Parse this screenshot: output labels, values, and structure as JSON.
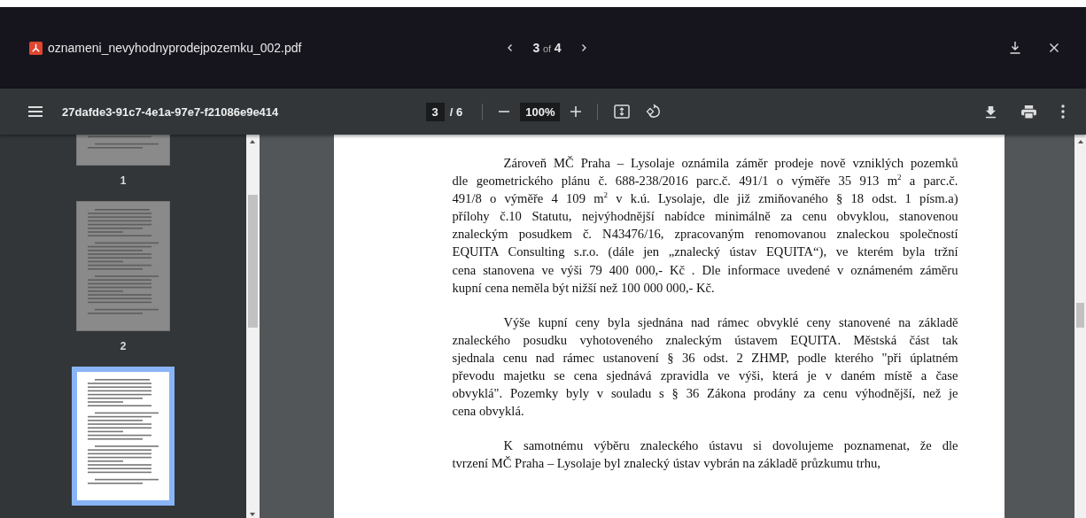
{
  "header": {
    "file_name": "oznameni_nevyhodnyprodejpozemku_002.pdf",
    "pager": {
      "current": "3",
      "of": "of",
      "total": "4"
    }
  },
  "toolbar": {
    "document_title": "27dafde3-91c7-4e1a-97e7-f21086e9e414",
    "page_input": "3",
    "page_total": "/ 6",
    "zoom": "100%"
  },
  "thumbnails": [
    {
      "label": "1",
      "selected": false
    },
    {
      "label": "2",
      "selected": false
    },
    {
      "selected": true
    }
  ],
  "page": {
    "paragraphs": [
      {
        "lines": [
          "Zároveň MČ Praha – Lysolaje oznámila záměr prodeje nově vzniklých pozemků",
          "dle geometrického plánu č. 688-238/2016 parc.č. 491/1 o výměře 35 913 m$^{2}$ a parc.č.",
          "491/8 o výměře 4 109 m$^{2}$ v k.ú. Lysolaje, dle již zmiňovaného § 18 odst. 1 písm.a)",
          "přílohy č.10 Statutu, nejvýhodnější nabídce minimálně za cenu obvyklou, stanovenou",
          "znaleckým posudkem č. N43476/16, zpracovaným renomovanou znaleckou společností",
          "EQUITA Consulting s.r.o. (dále jen „znalecký ústav EQUITA“), ve kterém byla tržní",
          "cena stanovena ve výši 79 400 000,- Kč . Dle informace uvedené v oznámeném záměru",
          "kupní cena neměla být nižší než 100 000 000,- Kč."
        ]
      },
      {
        "lines": [
          "Výše kupní ceny byla sjednána nad rámec obvyklé ceny stanovené na základě",
          "znaleckého posudku vyhotoveného znaleckým ústavem EQUITA. Městská část tak",
          "sjednala cenu nad rámec ustanovení § 36 odst. 2 ZHMP, podle kterého \"při úplatném",
          "převodu majetku se cena sjednává zpravidla ve výši, která je v daném místě a čase",
          "obvyklá\". Pozemky byly v souladu s § 36 Zákona prodány za cenu výhodnější, než je",
          "cena obvyklá."
        ]
      },
      {
        "lines": [
          "K samotnému výběru znaleckého ústavu si dovolujeme poznamenat, že dle",
          "tvrzení MČ Praha – Lysolaje byl znalecký ústav vybrán na základě průzkumu trhu,"
        ]
      }
    ]
  }
}
